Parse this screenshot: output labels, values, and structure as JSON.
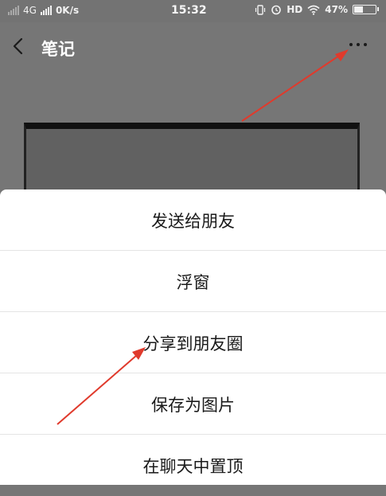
{
  "status_bar": {
    "network": "4G",
    "speed": "0K/s",
    "time": "15:32",
    "hd": "HD",
    "battery": "47%",
    "battery_level": 0.47
  },
  "header": {
    "title": "笔记"
  },
  "menu": {
    "items": [
      {
        "label": "发送给朋友"
      },
      {
        "label": "浮窗"
      },
      {
        "label": "分享到朋友圈"
      },
      {
        "label": "保存为图片"
      },
      {
        "label": "在聊天中置顶"
      }
    ]
  },
  "colors": {
    "annotation": "#e03a2c",
    "sheet_background": "#ffffff",
    "dim_background": "#767676"
  },
  "icons": [
    "back-icon",
    "more-icon",
    "vibrate-icon",
    "alarm-icon",
    "wifi-icon",
    "battery-icon"
  ]
}
